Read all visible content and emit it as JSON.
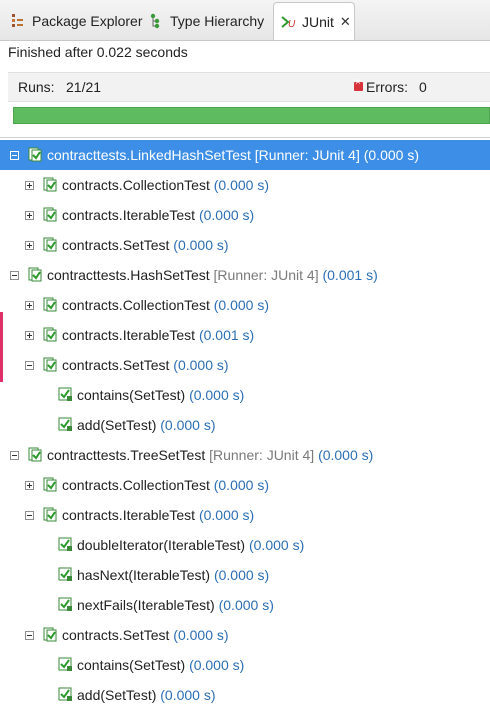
{
  "tabs": [
    {
      "label": "Package Explorer",
      "icon": "package-explorer-icon"
    },
    {
      "label": "Type Hierarchy",
      "icon": "type-hierarchy-icon"
    },
    {
      "label": "JUnit",
      "icon": "junit-icon",
      "active": true,
      "close": "✕"
    }
  ],
  "status": "Finished after 0.022 seconds",
  "counters": {
    "runs_label": "Runs:",
    "runs_value": "21/21",
    "errors_label": "Errors:",
    "errors_value": "0"
  },
  "progress": {
    "fraction": 1.0,
    "color": "#5fbb5f"
  },
  "tree": [
    {
      "level": 0,
      "expanded": true,
      "selected": true,
      "name": "contracttests.LinkedHashSetTest",
      "runner": "[Runner: JUnit 4]",
      "time": "(0.000 s)"
    },
    {
      "level": 1,
      "expanded": false,
      "name": "contracts.CollectionTest",
      "time": "(0.000 s)"
    },
    {
      "level": 1,
      "expanded": false,
      "name": "contracts.IterableTest",
      "time": "(0.000 s)"
    },
    {
      "level": 1,
      "expanded": false,
      "name": "contracts.SetTest",
      "time": "(0.000 s)"
    },
    {
      "level": 0,
      "expanded": true,
      "name": "contracttests.HashSetTest",
      "runner": "[Runner: JUnit 4]",
      "time": "(0.001 s)"
    },
    {
      "level": 1,
      "expanded": false,
      "name": "contracts.CollectionTest",
      "time": "(0.000 s)"
    },
    {
      "level": 1,
      "expanded": false,
      "name": "contracts.IterableTest",
      "time": "(0.001 s)"
    },
    {
      "level": 1,
      "expanded": true,
      "name": "contracts.SetTest",
      "time": "(0.000 s)"
    },
    {
      "level": 2,
      "leaf": true,
      "name": "contains(SetTest)",
      "time": "(0.000 s)"
    },
    {
      "level": 2,
      "leaf": true,
      "name": "add(SetTest)",
      "time": "(0.000 s)"
    },
    {
      "level": 0,
      "expanded": true,
      "name": "contracttests.TreeSetTest",
      "runner": "[Runner: JUnit 4]",
      "time": "(0.000 s)"
    },
    {
      "level": 1,
      "expanded": false,
      "name": "contracts.CollectionTest",
      "time": "(0.000 s)"
    },
    {
      "level": 1,
      "expanded": true,
      "name": "contracts.IterableTest",
      "time": "(0.000 s)"
    },
    {
      "level": 2,
      "leaf": true,
      "name": "doubleIterator(IterableTest)",
      "time": "(0.000 s)"
    },
    {
      "level": 2,
      "leaf": true,
      "name": "hasNext(IterableTest)",
      "time": "(0.000 s)"
    },
    {
      "level": 2,
      "leaf": true,
      "name": "nextFails(IterableTest)",
      "time": "(0.000 s)"
    },
    {
      "level": 1,
      "expanded": true,
      "name": "contracts.SetTest",
      "time": "(0.000 s)"
    },
    {
      "level": 2,
      "leaf": true,
      "name": "contains(SetTest)",
      "time": "(0.000 s)"
    },
    {
      "level": 2,
      "leaf": true,
      "name": "add(SetTest)",
      "time": "(0.000 s)"
    }
  ]
}
